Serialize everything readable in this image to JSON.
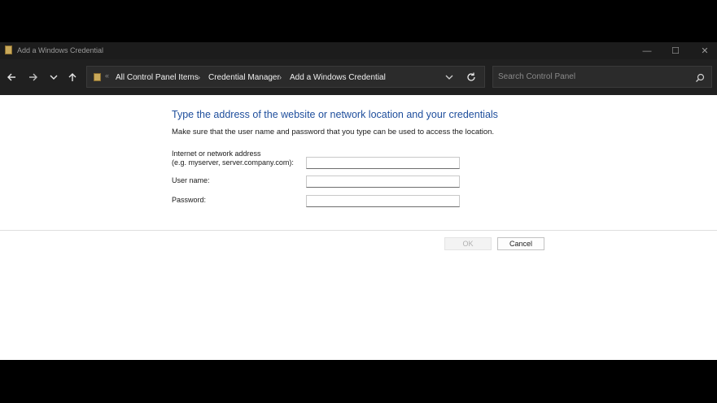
{
  "window": {
    "title": "Add a Windows Credential",
    "controls": {
      "minimize": "—",
      "maximize": "☐",
      "close": "✕"
    }
  },
  "nav": {
    "back_icon": "back-arrow-icon",
    "forward_icon": "forward-arrow-icon",
    "recent_icon": "chevron-down-icon",
    "up_icon": "up-arrow-icon"
  },
  "address_bar": {
    "overflow": "«",
    "breadcrumbs": [
      "All Control Panel Items",
      "Credential Manager",
      "Add a Windows Credential"
    ],
    "separator": "›"
  },
  "search": {
    "placeholder": "Search Control Panel"
  },
  "form": {
    "heading": "Type the address of the website or network location and your credentials",
    "description": "Make sure that the user name and password that you type can be used to access the location.",
    "address_label_line1": "Internet or network address",
    "address_label_line2": "(e.g. myserver, server.company.com):",
    "address_value": "",
    "username_label": "User name:",
    "username_value": "",
    "password_label": "Password:",
    "password_value": ""
  },
  "buttons": {
    "ok": "OK",
    "cancel": "Cancel"
  },
  "colors": {
    "accent": "#1e4e9c",
    "titlebar": "#1c1c1c",
    "navbar": "#202020",
    "folder": "#c9a95a"
  }
}
